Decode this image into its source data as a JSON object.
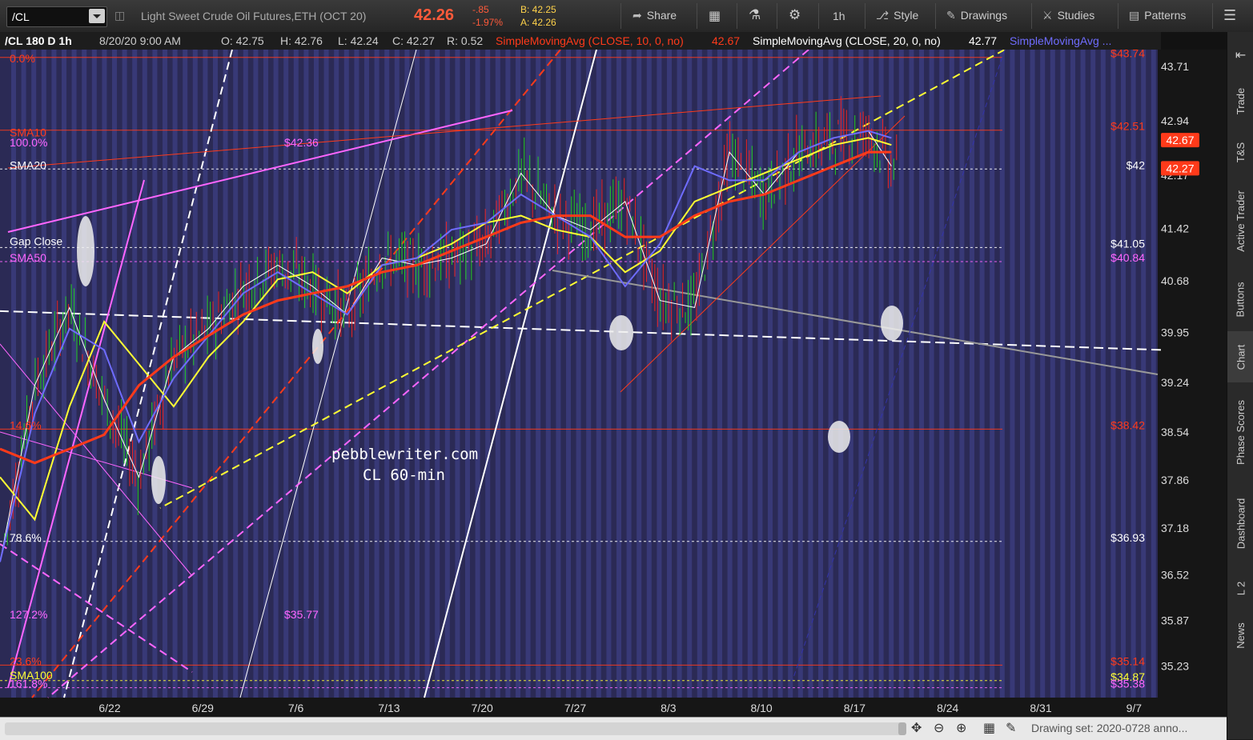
{
  "toolbar": {
    "symbol": "/CL",
    "description": "Light Sweet Crude Oil Futures,ETH (OCT 20)",
    "last": "42.26",
    "change": "-.85",
    "change_pct": "-1.97%",
    "bid": "B: 42.25",
    "ask": "A: 42.26",
    "share": "Share",
    "timeframe": "1h",
    "style": "Style",
    "drawings": "Drawings",
    "studies": "Studies",
    "patterns": "Patterns"
  },
  "infobar": {
    "symbol": "/CL 180 D 1h",
    "datetime": "8/20/20 9:00 AM",
    "open": "O: 42.75",
    "high": "H: 42.76",
    "low": "L: 42.24",
    "close": "C: 42.27",
    "range": "R: 0.52",
    "sma10_label": "SimpleMovingAvg (CLOSE, 10, 0, no)",
    "sma10_value": "42.67",
    "sma20_label": "SimpleMovingAvg (CLOSE, 20, 0, no)",
    "sma20_value": "42.77",
    "sma_more": "SimpleMovingAvg ..."
  },
  "right_panel": [
    "Trade",
    "T&S",
    "Active Trader",
    "Buttons",
    "Chart",
    "Phase Scores",
    "Dashboard",
    "L 2",
    "News"
  ],
  "bottom": {
    "drawing_set": "Drawing set: 2020-0728 anno..."
  },
  "colors": {
    "background": "#2b2a55",
    "stripe": "#3b3c7e",
    "sma10": "#ff3a1a",
    "sma20": "#ffff33",
    "sma50": "#6f6cff",
    "fib": "#ff3a1a",
    "magenta": "#ff66ff"
  },
  "chart_data": {
    "type": "candlestick",
    "symbol": "/CL",
    "timeframe": "60-min",
    "watermark": [
      "pebblewriter.com",
      "CL 60-min"
    ],
    "x_ticks": [
      "6/22",
      "6/29",
      "7/6",
      "7/13",
      "7/20",
      "7/27",
      "8/3",
      "8/10",
      "8/17",
      "8/24",
      "8/31",
      "9/7"
    ],
    "y_ticks": [
      "43.71",
      "42.94",
      "42.17",
      "41.42",
      "40.68",
      "39.95",
      "39.24",
      "38.54",
      "37.86",
      "37.18",
      "36.52",
      "35.87",
      "35.23"
    ],
    "price_markers": [
      {
        "label": "42.67",
        "y": 42.67,
        "color": "#ff3a1a"
      },
      {
        "label": "42.27",
        "y": 42.27,
        "color": "#ff3a1a"
      }
    ],
    "series": [
      {
        "name": "SimpleMovingAvg (CLOSE, 10, 0, no)",
        "color": "#ffffff",
        "x": [
          0,
          0.03,
          0.06,
          0.09,
          0.12,
          0.15,
          0.18,
          0.21,
          0.24,
          0.27,
          0.3,
          0.33,
          0.36,
          0.39,
          0.42,
          0.45,
          0.48,
          0.51,
          0.54,
          0.57,
          0.6,
          0.63,
          0.66,
          0.69,
          0.72,
          0.75,
          0.77
        ],
        "values": [
          36.7,
          39.2,
          40.3,
          39.0,
          37.9,
          39.6,
          40.0,
          40.6,
          40.9,
          40.6,
          40.2,
          41.0,
          40.9,
          41.0,
          41.2,
          42.2,
          41.6,
          41.4,
          41.8,
          40.4,
          40.3,
          42.5,
          41.9,
          42.5,
          42.7,
          42.8,
          42.3
        ]
      },
      {
        "name": "SimpleMovingAvg (CLOSE, 20, 0, no)",
        "color": "#ffff33",
        "x": [
          0,
          0.03,
          0.06,
          0.09,
          0.12,
          0.15,
          0.18,
          0.21,
          0.24,
          0.27,
          0.3,
          0.33,
          0.36,
          0.39,
          0.42,
          0.45,
          0.48,
          0.51,
          0.54,
          0.57,
          0.6,
          0.63,
          0.66,
          0.69,
          0.72,
          0.75,
          0.77
        ],
        "values": [
          37.9,
          37.3,
          38.9,
          40.1,
          39.5,
          38.9,
          39.6,
          40.1,
          40.7,
          40.8,
          40.5,
          40.9,
          41.0,
          41.2,
          41.5,
          41.6,
          41.4,
          41.3,
          40.8,
          41.1,
          41.8,
          42.0,
          42.2,
          42.4,
          42.6,
          42.7,
          42.6
        ]
      },
      {
        "name": "SimpleMovingAvg 50",
        "color": "#6f6cff",
        "x": [
          0,
          0.03,
          0.06,
          0.09,
          0.12,
          0.15,
          0.18,
          0.21,
          0.24,
          0.27,
          0.3,
          0.33,
          0.36,
          0.39,
          0.42,
          0.45,
          0.48,
          0.51,
          0.54,
          0.57,
          0.6,
          0.63,
          0.66,
          0.69,
          0.72,
          0.75,
          0.77
        ],
        "values": [
          36.7,
          38.8,
          40.0,
          39.7,
          38.4,
          39.3,
          39.9,
          40.5,
          40.8,
          40.5,
          40.2,
          40.9,
          41.0,
          41.4,
          41.5,
          41.9,
          41.6,
          41.3,
          40.6,
          41.2,
          42.3,
          42.1,
          42.1,
          42.5,
          42.7,
          42.8,
          42.7
        ]
      },
      {
        "name": "SimpleMovingAvg 100",
        "color": "#ff3a1a",
        "x": [
          0,
          0.03,
          0.06,
          0.09,
          0.12,
          0.15,
          0.18,
          0.21,
          0.24,
          0.27,
          0.3,
          0.33,
          0.36,
          0.39,
          0.42,
          0.45,
          0.48,
          0.51,
          0.54,
          0.57,
          0.6,
          0.63,
          0.66,
          0.69,
          0.72,
          0.75,
          0.77
        ],
        "values": [
          38.3,
          38.1,
          38.3,
          38.5,
          39.2,
          39.6,
          39.9,
          40.2,
          40.4,
          40.5,
          40.6,
          40.8,
          40.9,
          41.1,
          41.3,
          41.5,
          41.6,
          41.6,
          41.3,
          41.3,
          41.6,
          41.8,
          41.9,
          42.1,
          42.3,
          42.5,
          42.5
        ]
      }
    ],
    "annotations": [
      {
        "text": "0.0%",
        "side": "left",
        "y": 43.77,
        "color": "#ff3a1a"
      },
      {
        "text": "SMA10",
        "side": "left",
        "y": 42.72,
        "color": "#ff3a1a"
      },
      {
        "text": "100.0%",
        "side": "left",
        "y": 42.58,
        "color": "#ff66ff"
      },
      {
        "text": "SMA20",
        "side": "left",
        "y": 42.26,
        "color": "#ffffff"
      },
      {
        "text": "Gap Close",
        "side": "left",
        "y": 41.18,
        "color": "#ffffff"
      },
      {
        "text": "SMA50",
        "side": "left",
        "y": 40.95,
        "color": "#ff66ff"
      },
      {
        "text": "14.6%",
        "side": "left",
        "y": 38.58,
        "color": "#ff3a1a"
      },
      {
        "text": "78.6%",
        "side": "left",
        "y": 36.99,
        "color": "#ffffff"
      },
      {
        "text": "127.2%",
        "side": "left",
        "y": 35.9,
        "color": "#ff66ff"
      },
      {
        "text": "23.6%",
        "side": "left",
        "y": 35.24,
        "color": "#ff3a1a"
      },
      {
        "text": "SMA100",
        "side": "left",
        "y": 35.04,
        "color": "#ffff33"
      },
      {
        "text": "161.8%",
        "side": "left",
        "y": 34.92,
        "color": "#ff66ff"
      },
      {
        "text": "$42.36",
        "side": "mid",
        "y": 42.58,
        "color": "#ff66ff"
      },
      {
        "text": "$35.77",
        "side": "mid",
        "y": 35.9,
        "color": "#ff66ff"
      },
      {
        "text": "$43.74",
        "side": "right",
        "y": 43.84,
        "color": "#ff3a1a"
      },
      {
        "text": "$42.51",
        "side": "right",
        "y": 42.81,
        "color": "#ff3a1a"
      },
      {
        "text": "$42",
        "side": "right",
        "y": 42.26,
        "color": "#ffffff"
      },
      {
        "text": "$41.05",
        "side": "right",
        "y": 41.15,
        "color": "#ffffff"
      },
      {
        "text": "$40.84",
        "side": "right",
        "y": 40.95,
        "color": "#ff66ff"
      },
      {
        "text": "$38.42",
        "side": "right",
        "y": 38.58,
        "color": "#ff3a1a"
      },
      {
        "text": "$36.93",
        "side": "right",
        "y": 36.99,
        "color": "#ffffff"
      },
      {
        "text": "$35.14",
        "side": "right",
        "y": 35.24,
        "color": "#ff3a1a"
      },
      {
        "text": "$34.87",
        "side": "right",
        "y": 35.02,
        "color": "#ffff33"
      },
      {
        "text": "$35.38",
        "side": "right",
        "y": 34.92,
        "color": "#ff66ff"
      }
    ]
  }
}
